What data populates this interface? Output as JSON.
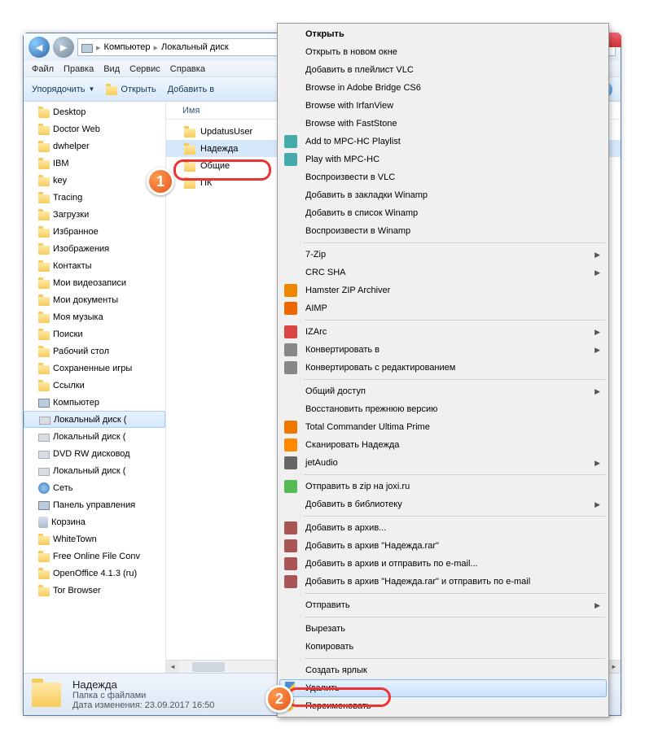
{
  "nav": {
    "crumbs": [
      "Компьютер",
      "Локальный диск"
    ]
  },
  "menubar": [
    "Файл",
    "Правка",
    "Вид",
    "Сервис",
    "Справка"
  ],
  "toolbar": {
    "organize": "Упорядочить",
    "open": "Открыть",
    "include": "Добавить в"
  },
  "tree": [
    {
      "label": "Desktop",
      "icon": "folder"
    },
    {
      "label": "Doctor Web",
      "icon": "folder"
    },
    {
      "label": "dwhelper",
      "icon": "folder"
    },
    {
      "label": "IBM",
      "icon": "folder"
    },
    {
      "label": "key",
      "icon": "folder"
    },
    {
      "label": "Tracing",
      "icon": "folder"
    },
    {
      "label": "Загрузки",
      "icon": "folder"
    },
    {
      "label": "Избранное",
      "icon": "folder"
    },
    {
      "label": "Изображения",
      "icon": "folder"
    },
    {
      "label": "Контакты",
      "icon": "folder"
    },
    {
      "label": "Мои видеозаписи",
      "icon": "folder"
    },
    {
      "label": "Мои документы",
      "icon": "folder"
    },
    {
      "label": "Моя музыка",
      "icon": "folder"
    },
    {
      "label": "Поиски",
      "icon": "folder"
    },
    {
      "label": "Рабочий стол",
      "icon": "folder"
    },
    {
      "label": "Сохраненные игры",
      "icon": "folder"
    },
    {
      "label": "Ссылки",
      "icon": "folder"
    },
    {
      "label": "Компьютер",
      "icon": "pc"
    },
    {
      "label": "Локальный диск (",
      "icon": "drive",
      "selected": true
    },
    {
      "label": "Локальный диск (",
      "icon": "drive"
    },
    {
      "label": "DVD RW дисковод",
      "icon": "drive"
    },
    {
      "label": "Локальный диск (",
      "icon": "drive"
    },
    {
      "label": "Сеть",
      "icon": "net"
    },
    {
      "label": "Панель управления",
      "icon": "pc"
    },
    {
      "label": "Корзина",
      "icon": "bin"
    },
    {
      "label": "WhiteTown",
      "icon": "folder"
    },
    {
      "label": "Free Online File Conv",
      "icon": "folder"
    },
    {
      "label": "OpenOffice 4.1.3 (ru)",
      "icon": "folder"
    },
    {
      "label": "Tor Browser",
      "icon": "folder"
    }
  ],
  "columns": {
    "name": "Имя"
  },
  "files": [
    {
      "label": "UpdatusUser",
      "selected": false
    },
    {
      "label": "Надежда",
      "selected": true
    },
    {
      "label": "Общие",
      "selected": false
    },
    {
      "label": "ПК",
      "selected": false
    }
  ],
  "status": {
    "name": "Надежда",
    "type": "Папка с файлами",
    "date_label": "Дата изменения:",
    "date_value": "23.09.2017 16:50"
  },
  "context": [
    {
      "label": "Открыть",
      "bold": true
    },
    {
      "label": "Открыть в новом окне"
    },
    {
      "label": "Добавить в плейлист VLC"
    },
    {
      "label": "Browse in Adobe Bridge CS6"
    },
    {
      "label": "Browse with IrfanView"
    },
    {
      "label": "Browse with FastStone"
    },
    {
      "label": "Add to MPC-HC Playlist",
      "icon": "#4aa"
    },
    {
      "label": "Play with MPC-HC",
      "icon": "#4aa"
    },
    {
      "label": "Воспроизвести в VLC"
    },
    {
      "label": "Добавить в закладки Winamp"
    },
    {
      "label": "Добавить в список Winamp"
    },
    {
      "label": "Воспроизвести в Winamp"
    },
    {
      "sep": true
    },
    {
      "label": "7-Zip",
      "sub": true
    },
    {
      "label": "CRC SHA",
      "sub": true
    },
    {
      "label": "Hamster ZIP Archiver",
      "icon": "#e80"
    },
    {
      "label": "AIMP",
      "icon": "#e60"
    },
    {
      "sep": true
    },
    {
      "label": "IZArc",
      "icon": "#d44",
      "sub": true
    },
    {
      "label": "Конвертировать в",
      "icon": "#888",
      "sub": true
    },
    {
      "label": "Конвертировать с редактированием",
      "icon": "#888"
    },
    {
      "sep": true
    },
    {
      "label": "Общий доступ",
      "sub": true
    },
    {
      "label": "Восстановить прежнюю версию"
    },
    {
      "label": "Total Commander Ultima Prime",
      "icon": "#e70"
    },
    {
      "label": "Сканировать Надежда",
      "icon": "#f80"
    },
    {
      "label": "jetAudio",
      "icon": "#666",
      "sub": true
    },
    {
      "sep": true
    },
    {
      "label": "Отправить в zip на joxi.ru",
      "icon": "#5b5"
    },
    {
      "label": "Добавить в библиотеку",
      "sub": true
    },
    {
      "sep": true
    },
    {
      "label": "Добавить в архив...",
      "icon": "#a55"
    },
    {
      "label": "Добавить в архив \"Надежда.rar\"",
      "icon": "#a55"
    },
    {
      "label": "Добавить в архив и отправить по e-mail...",
      "icon": "#a55"
    },
    {
      "label": "Добавить в архив \"Надежда.rar\" и отправить по e-mail",
      "icon": "#a55"
    },
    {
      "sep": true
    },
    {
      "label": "Отправить",
      "sub": true
    },
    {
      "sep": true
    },
    {
      "label": "Вырезать"
    },
    {
      "label": "Копировать"
    },
    {
      "sep": true
    },
    {
      "label": "Создать ярлык"
    },
    {
      "label": "Удалить",
      "shield": true,
      "hl": true
    },
    {
      "label": "Переименовать",
      "shield": true
    }
  ],
  "badges": {
    "b1": "1",
    "b2": "2"
  }
}
